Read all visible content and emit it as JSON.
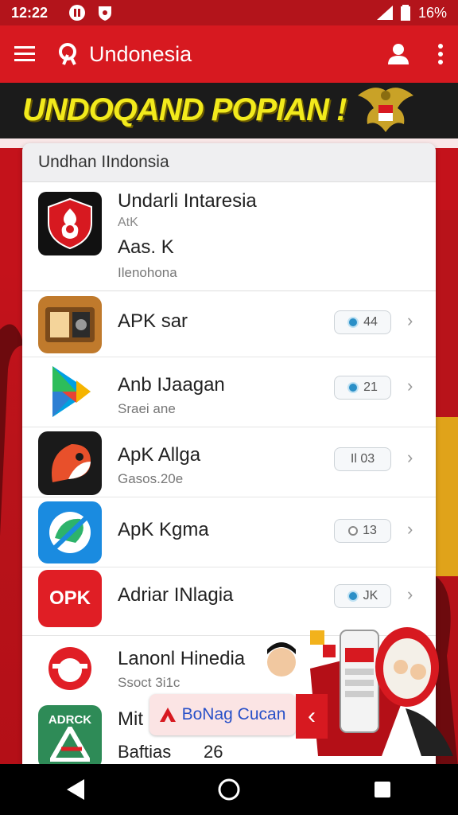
{
  "status_bar": {
    "time": "12:22",
    "battery": "16%"
  },
  "app_bar": {
    "title": "Undonesia"
  },
  "banner": {
    "title": "UNDOQAND POPIAN !"
  },
  "card": {
    "header": "Undhan IIndonsia",
    "featured": {
      "name": "Undarli Intaresia",
      "sub": "AtK",
      "size": "Aas. K",
      "developer": "Ilenohona"
    },
    "items": [
      {
        "name": "APK sar",
        "sub": "",
        "badge": "44",
        "badge_icon": "blue-dot"
      },
      {
        "name": "Anb IJaagan",
        "sub": "Sraei ane",
        "badge": "21",
        "badge_icon": "blue-dot"
      },
      {
        "name": "ApK Allga",
        "sub": "Gasos.20e",
        "badge": "Il 03",
        "badge_icon": "none"
      },
      {
        "name": "ApK Kgma",
        "sub": "",
        "badge": "13",
        "badge_icon": "gray-ring"
      },
      {
        "name": "Adriar INlagia",
        "sub": "",
        "badge": "JK",
        "badge_icon": "blue-dot"
      },
      {
        "name": "Lanonl Hinedia",
        "sub": "Ssoct 3i1c",
        "badge": "",
        "badge_icon": "none"
      },
      {
        "name": "Mit",
        "sub": "Baftias",
        "badge": "26",
        "badge_icon": "none"
      }
    ],
    "icon_texts": {
      "opk": "OPK",
      "adrck": "ADRCK"
    }
  },
  "promo": {
    "button_label": "BoNag Cucan"
  },
  "colors": {
    "primary": "#d71920",
    "status": "#b3141b",
    "accent_yellow": "#f2ea1c"
  }
}
